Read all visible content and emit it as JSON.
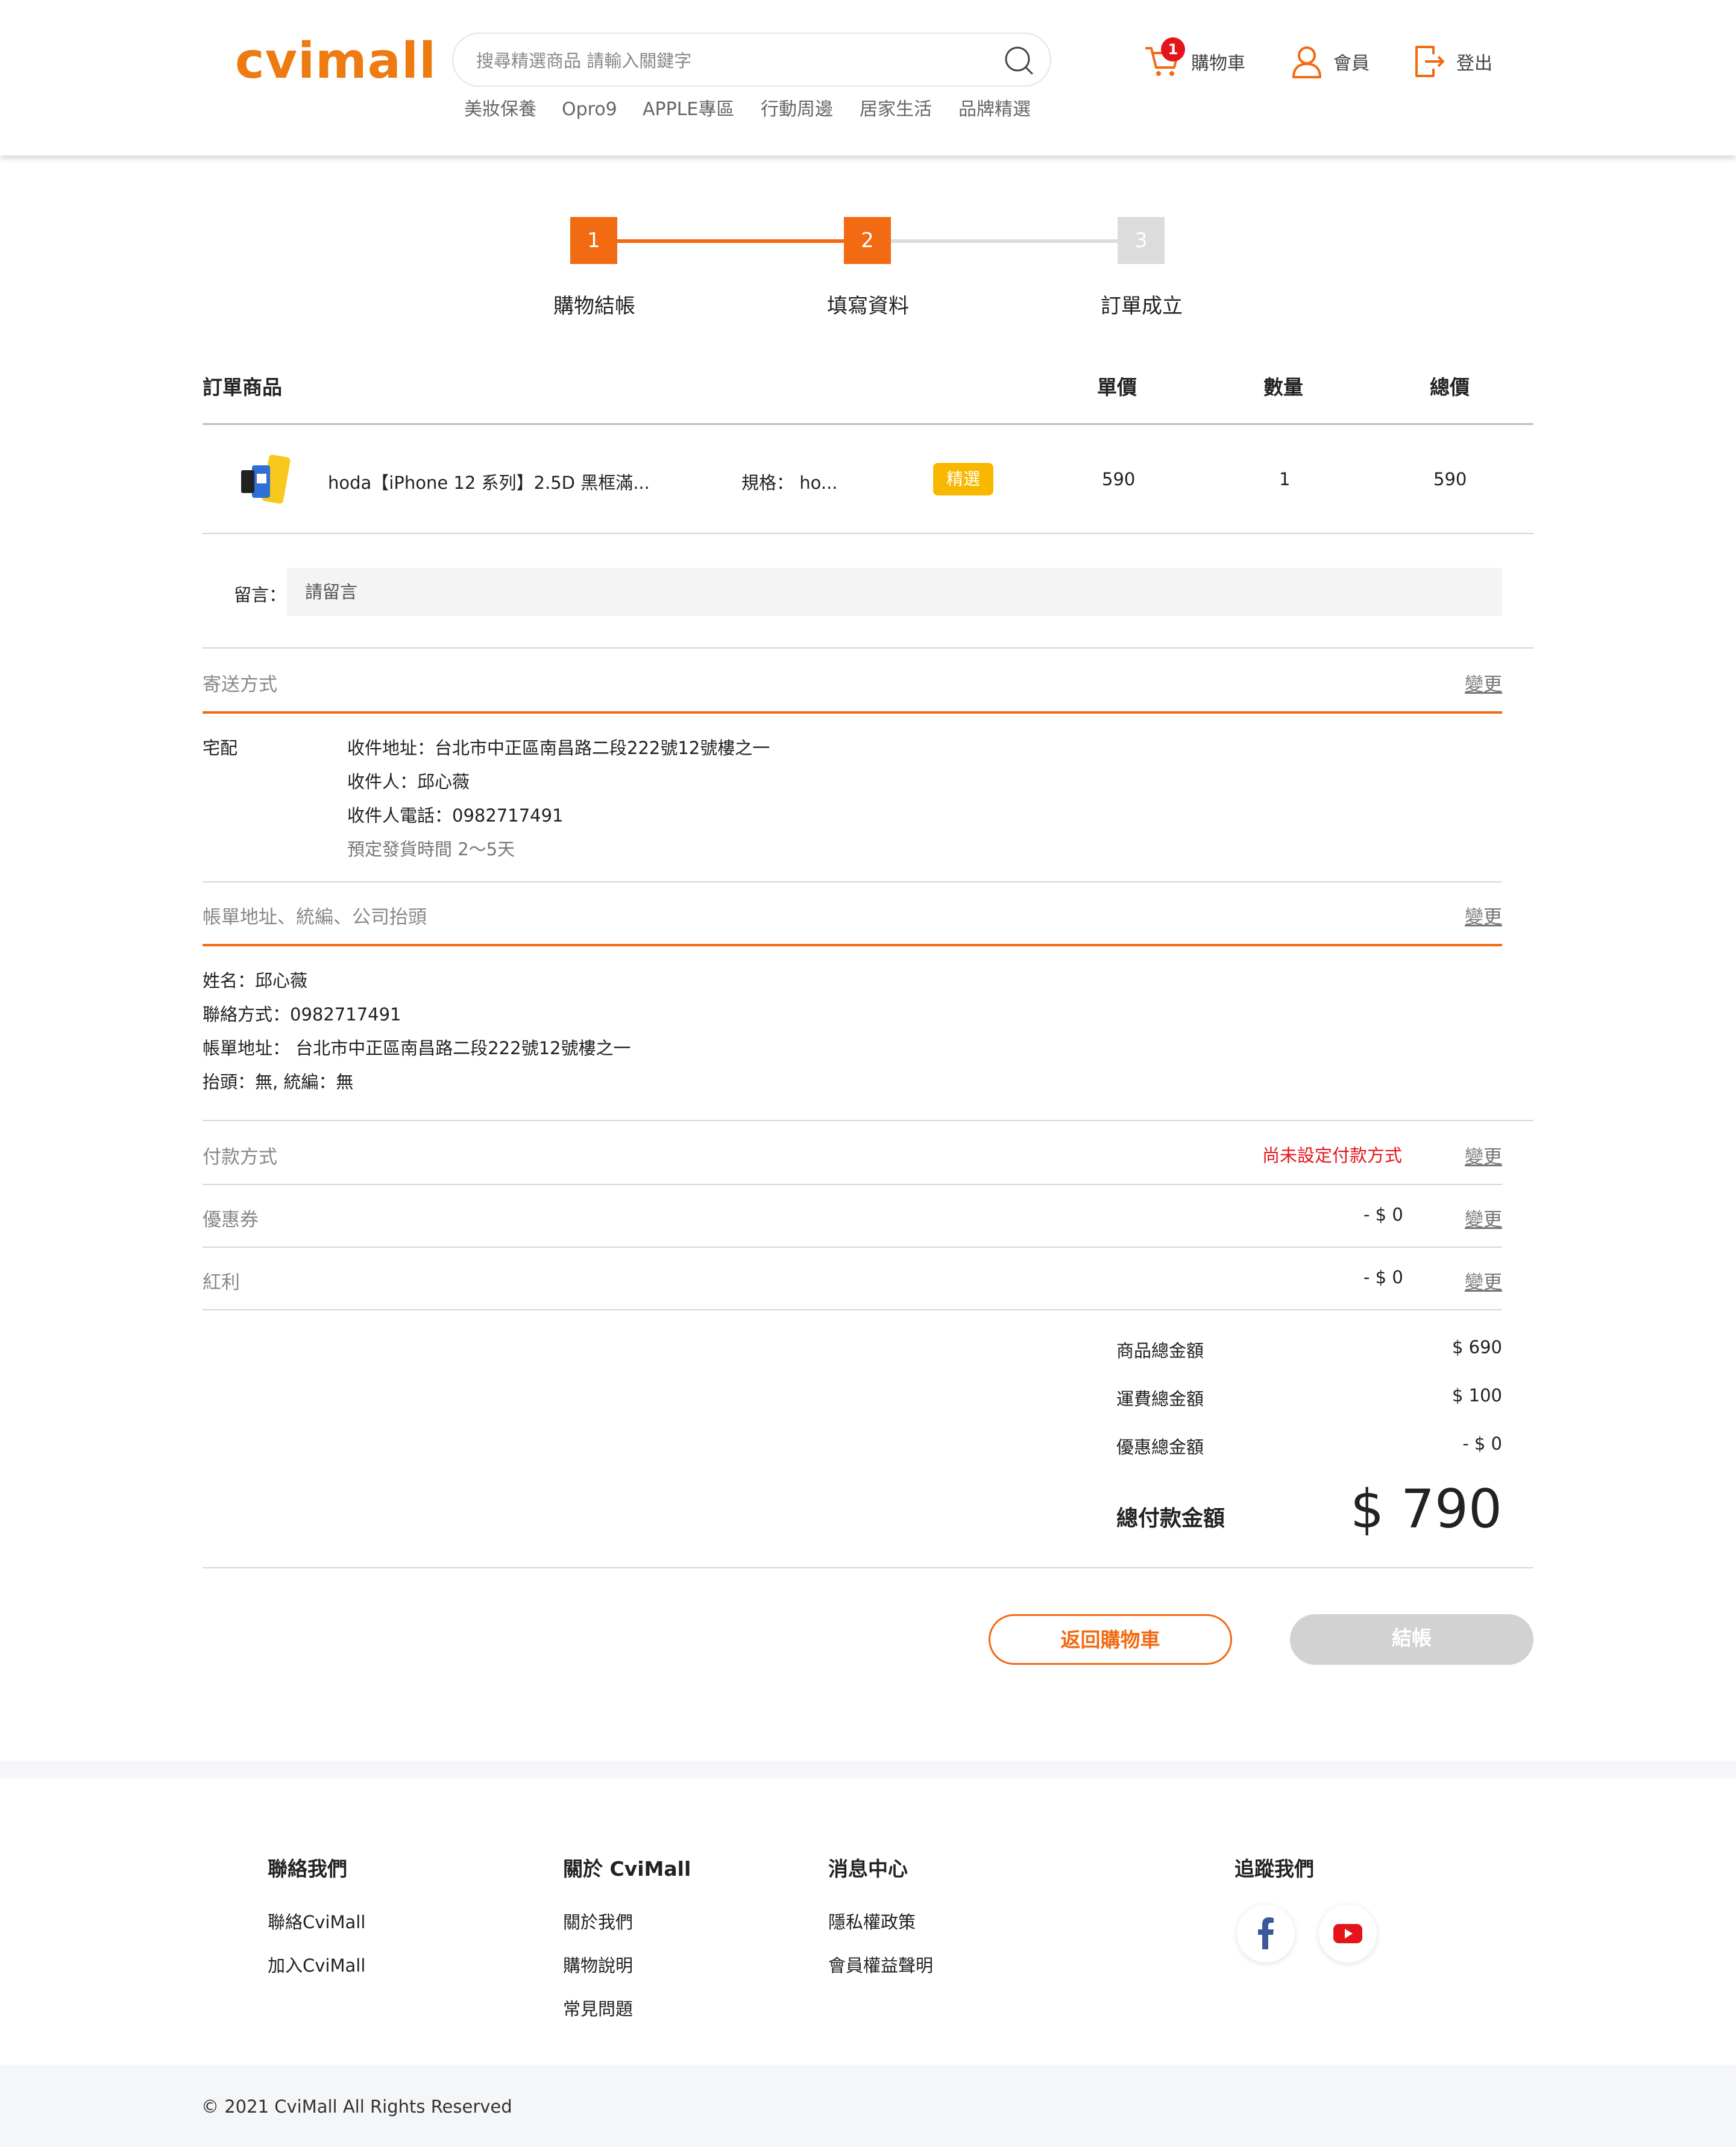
{
  "header": {
    "logo": "cvimall",
    "search_placeholder": "搜尋精選商品 請輸入關鍵字",
    "nav": [
      "美妝保養",
      "Opro9",
      "APPLE專區",
      "行動周邊",
      "居家生活",
      "品牌精選"
    ],
    "cart_label": "購物車",
    "cart_count": "1",
    "member_label": "會員",
    "logout_label": "登出"
  },
  "steps": [
    {
      "num": "1",
      "label": "購物結帳"
    },
    {
      "num": "2",
      "label": "填寫資料"
    },
    {
      "num": "3",
      "label": "訂單成立"
    }
  ],
  "table": {
    "headers": {
      "product": "訂單商品",
      "unit_price": "單價",
      "qty": "數量",
      "total": "總價"
    },
    "rows": [
      {
        "name": "hoda【iPhone 12 系列】2.5D 黑框滿...",
        "spec": "規格： ho...",
        "badge": "精選",
        "unit_price": "590",
        "qty": "1",
        "total": "590"
      }
    ]
  },
  "message": {
    "label": "留言：",
    "placeholder": "請留言"
  },
  "shipping": {
    "title": "寄送方式",
    "change": "變更",
    "method": "宅配",
    "address": "收件地址：台北市中正區南昌路二段222號12號樓之一",
    "recipient": "收件人：邱心薇",
    "phone": "收件人電話：0982717491",
    "eta": "預定發貨時間 2〜5天"
  },
  "billing": {
    "title": "帳單地址、統編、公司抬頭",
    "change": "變更",
    "name": "姓名：邱心薇",
    "contact": "聯絡方式：0982717491",
    "address": "帳單地址： 台北市中正區南昌路二段222號12號樓之一",
    "header_tax": "抬頭：無, 統編：無"
  },
  "payment": {
    "title": "付款方式",
    "status": "尚未設定付款方式",
    "change": "變更"
  },
  "coupon": {
    "title": "優惠券",
    "value": "- $ 0",
    "change": "變更"
  },
  "bonus": {
    "title": "紅利",
    "value": "- $ 0",
    "change": "變更"
  },
  "summary": {
    "items_label": "商品總金額",
    "items_value": "$ 690",
    "shipping_label": "運費總金額",
    "shipping_value": "$ 100",
    "discount_label": "優惠總金額",
    "discount_value": "- $ 0",
    "total_label": "總付款金額",
    "total_value": "$ 790"
  },
  "buttons": {
    "back": "返回購物車",
    "checkout": "結帳"
  },
  "footer": {
    "contact_title": "聯絡我們",
    "contact_links": [
      "聯絡CviMall",
      "加入CviMall"
    ],
    "about_title": "關於 CviMall",
    "about_links": [
      "關於我們",
      "購物說明",
      "常見問題"
    ],
    "news_title": "消息中心",
    "news_links": [
      "隱私權政策",
      "會員權益聲明"
    ],
    "follow_title": "追蹤我們",
    "copyright": "© 2021 CviMall All Rights Reserved"
  },
  "colors": {
    "accent": "#f26a12",
    "badge": "#f9b800",
    "alert": "#e5141b",
    "disabled": "#d2d2d2"
  }
}
